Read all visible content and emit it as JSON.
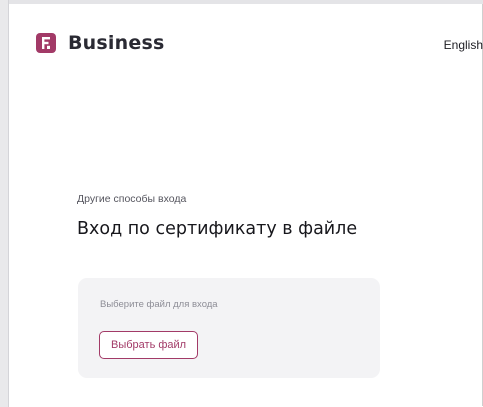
{
  "header": {
    "brand": "Business",
    "language_label": "English"
  },
  "main": {
    "section_label": "Другие способы входа",
    "title": "Вход по сертификату в файле",
    "card": {
      "hint": "Выберите файл для входа",
      "button_label": "Выбрать файл"
    }
  },
  "colors": {
    "accent": "#a23a67",
    "card_bg": "#f3f3f5",
    "text_primary": "#17171c"
  },
  "icons": {
    "logo": "brand-logo-icon"
  }
}
